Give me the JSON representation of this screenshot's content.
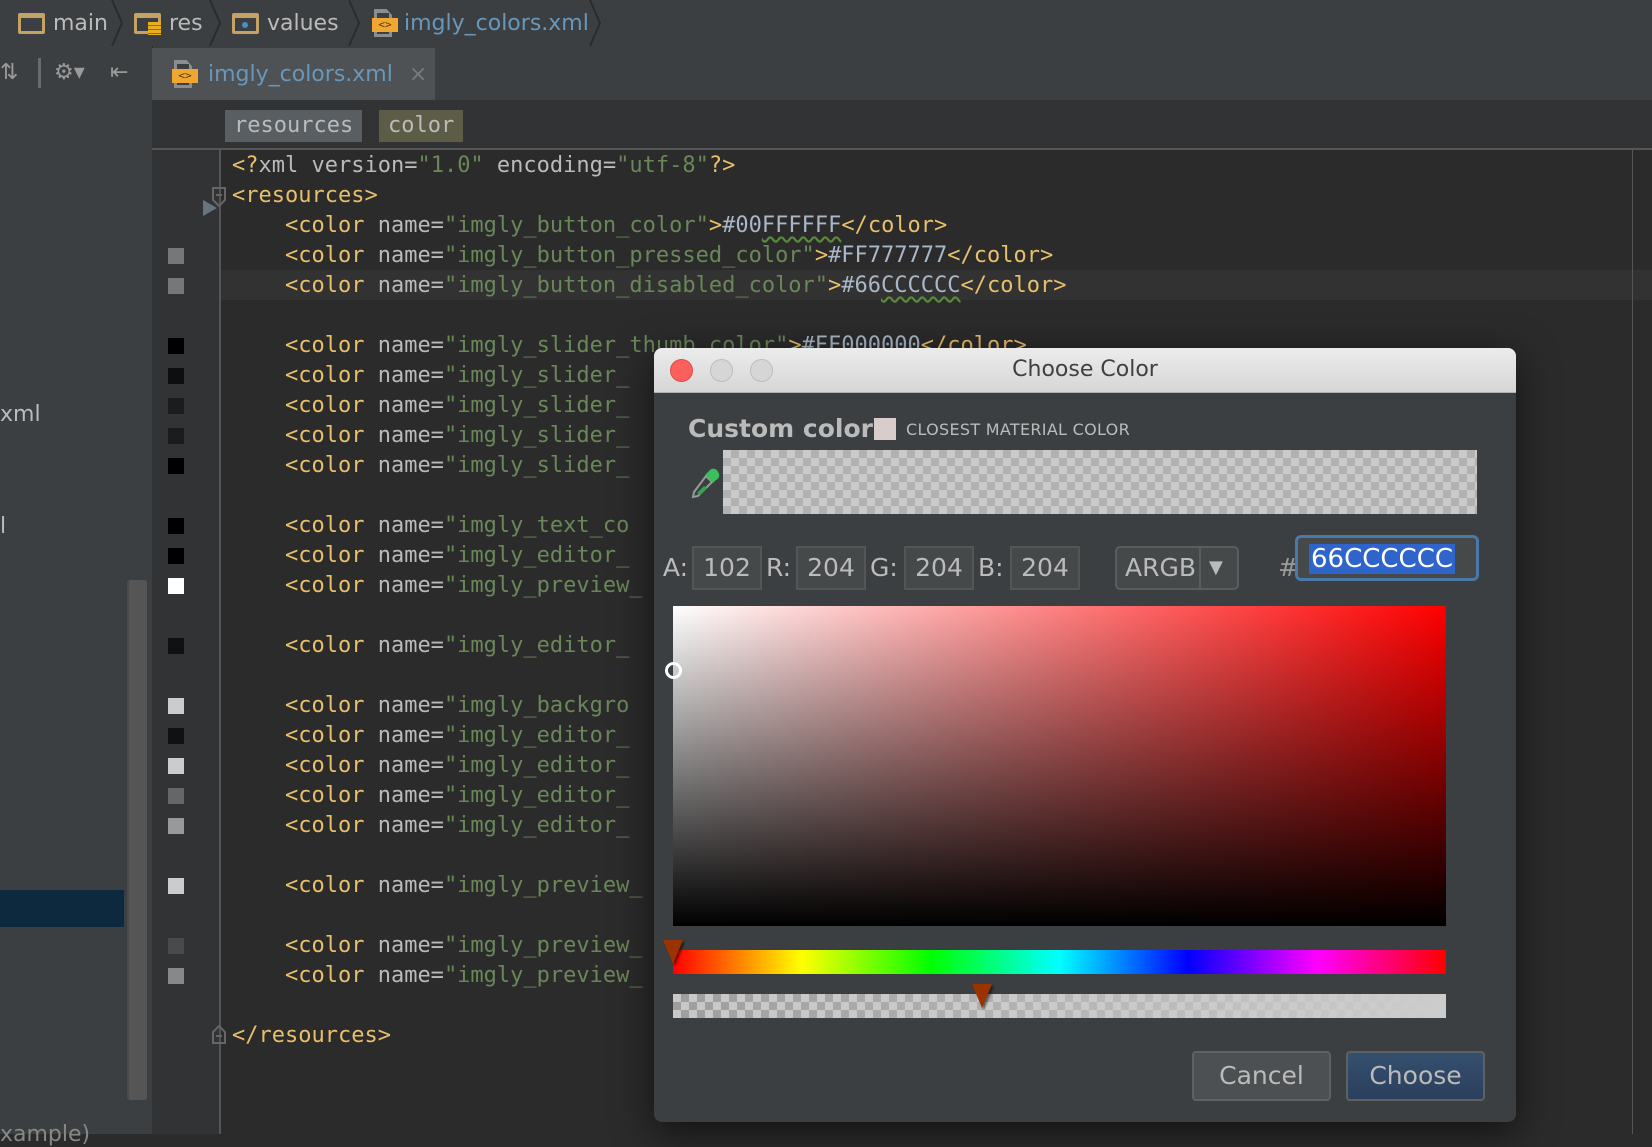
{
  "breadcrumb": {
    "items": [
      {
        "label": "main",
        "icon": "folder-icon"
      },
      {
        "label": "res",
        "icon": "resource-folder-icon"
      },
      {
        "label": "values",
        "icon": "values-folder-icon"
      },
      {
        "label": "imgly_colors.xml",
        "icon": "xml-file-icon"
      }
    ]
  },
  "toolbar": {
    "collapse_icon": "⇅",
    "gear_icon": "⚙▾",
    "hide_icon": "⇤"
  },
  "editor_tab": {
    "label": "imgly_colors.xml",
    "close": "×"
  },
  "left_panel": {
    "fragment_1": "xml",
    "fragment_2": "l",
    "fragment_3": "xample)"
  },
  "tag_path": [
    "resources",
    "color"
  ],
  "code": {
    "lines": [
      {
        "parts": [
          [
            "tag",
            "<?"
          ],
          [
            "attr",
            "xml version="
          ],
          [
            "str",
            "\"1.0\""
          ],
          [
            "attr",
            " encoding="
          ],
          [
            "str",
            "\"utf-8\""
          ],
          [
            "tag",
            "?>"
          ]
        ]
      },
      {
        "parts": [
          [
            "tag",
            "<resources>"
          ]
        ]
      },
      {
        "parts": [
          [
            "tag",
            "    <color "
          ],
          [
            "attr",
            "name="
          ],
          [
            "str",
            "\"imgly_button_color\""
          ],
          [
            "tag",
            ">"
          ],
          [
            "val",
            "#00"
          ],
          [
            "valsq",
            "FFFFFF"
          ],
          [
            "tag",
            "</color>"
          ]
        ]
      },
      {
        "parts": [
          [
            "tag",
            "    <color "
          ],
          [
            "attr",
            "name="
          ],
          [
            "str",
            "\"imgly_button_pressed_color\""
          ],
          [
            "tag",
            ">"
          ],
          [
            "val",
            "#FF777777"
          ],
          [
            "tag",
            "</color>"
          ]
        ],
        "swatch": "#777777"
      },
      {
        "parts": [
          [
            "tag",
            "    <color "
          ],
          [
            "attr",
            "name="
          ],
          [
            "str",
            "\"imgly_button_disabled_color\""
          ],
          [
            "tag",
            ">"
          ],
          [
            "val",
            "#66"
          ],
          [
            "valsq",
            "CCCCCC"
          ],
          [
            "tag",
            "</color>"
          ]
        ],
        "swatch": "#777777"
      },
      {
        "parts": []
      },
      {
        "parts": [
          [
            "tag",
            "    <color "
          ],
          [
            "attr",
            "name="
          ],
          [
            "str",
            "\"imgly_slider_thumb_color\""
          ],
          [
            "tag",
            ">"
          ],
          [
            "val",
            "#FF000000"
          ],
          [
            "tag",
            "</color>"
          ]
        ],
        "swatch": "#000000"
      },
      {
        "parts": [
          [
            "tag",
            "    <color "
          ],
          [
            "attr",
            "name="
          ],
          [
            "str",
            "\"imgly_slider_"
          ]
        ],
        "swatch": "#0e0e0e"
      },
      {
        "parts": [
          [
            "tag",
            "    <color "
          ],
          [
            "attr",
            "name="
          ],
          [
            "str",
            "\"imgly_slider_"
          ]
        ],
        "swatch": "#1c1c1c"
      },
      {
        "parts": [
          [
            "tag",
            "    <color "
          ],
          [
            "attr",
            "name="
          ],
          [
            "str",
            "\"imgly_slider_"
          ]
        ],
        "swatch": "#1c1c1c"
      },
      {
        "parts": [
          [
            "tag",
            "    <color "
          ],
          [
            "attr",
            "name="
          ],
          [
            "str",
            "\"imgly_slider_"
          ]
        ],
        "swatch": "#000000"
      },
      {
        "parts": []
      },
      {
        "parts": [
          [
            "tag",
            "    <color "
          ],
          [
            "attr",
            "name="
          ],
          [
            "str",
            "\"imgly_text_co"
          ]
        ],
        "swatch": "#000000"
      },
      {
        "parts": [
          [
            "tag",
            "    <color "
          ],
          [
            "attr",
            "name="
          ],
          [
            "str",
            "\"imgly_editor_"
          ]
        ],
        "swatch": "#000000"
      },
      {
        "parts": [
          [
            "tag",
            "    <color "
          ],
          [
            "attr",
            "name="
          ],
          [
            "str",
            "\"imgly_preview_"
          ]
        ],
        "swatch": "#ffffff"
      },
      {
        "parts": []
      },
      {
        "parts": [
          [
            "tag",
            "    <color "
          ],
          [
            "attr",
            "name="
          ],
          [
            "str",
            "\"imgly_editor_"
          ]
        ],
        "swatch": "#111111"
      },
      {
        "parts": []
      },
      {
        "parts": [
          [
            "tag",
            "    <color "
          ],
          [
            "attr",
            "name="
          ],
          [
            "str",
            "\"imgly_backgro"
          ]
        ],
        "swatch": "#cccccc"
      },
      {
        "parts": [
          [
            "tag",
            "    <color "
          ],
          [
            "attr",
            "name="
          ],
          [
            "str",
            "\"imgly_editor_"
          ]
        ],
        "swatch": "#111111"
      },
      {
        "parts": [
          [
            "tag",
            "    <color "
          ],
          [
            "attr",
            "name="
          ],
          [
            "str",
            "\"imgly_editor_"
          ]
        ],
        "swatch": "#cccccc"
      },
      {
        "parts": [
          [
            "tag",
            "    <color "
          ],
          [
            "attr",
            "name="
          ],
          [
            "str",
            "\"imgly_editor_"
          ]
        ],
        "swatch": "#666666"
      },
      {
        "parts": [
          [
            "tag",
            "    <color "
          ],
          [
            "attr",
            "name="
          ],
          [
            "str",
            "\"imgly_editor_"
          ]
        ],
        "swatch": "#999999"
      },
      {
        "parts": []
      },
      {
        "parts": [
          [
            "tag",
            "    <color "
          ],
          [
            "attr",
            "name="
          ],
          [
            "str",
            "\"imgly_preview_"
          ]
        ],
        "swatch": "#cccccc"
      },
      {
        "parts": []
      },
      {
        "parts": [
          [
            "tag",
            "    <color "
          ],
          [
            "attr",
            "name="
          ],
          [
            "str",
            "\"imgly_preview_"
          ]
        ],
        "swatch": "#4a4a4a"
      },
      {
        "parts": [
          [
            "tag",
            "    <color "
          ],
          [
            "attr",
            "name="
          ],
          [
            "str",
            "\"imgly_preview_"
          ]
        ],
        "swatch": "#888888"
      },
      {
        "parts": []
      },
      {
        "parts": [
          [
            "tag",
            "</resources>"
          ]
        ]
      }
    ]
  },
  "dialog": {
    "title": "Choose Color",
    "custom_color_label": "Custom color",
    "closest_material_label": "CLOSEST MATERIAL COLOR",
    "closest_material_color": "#d8cdca",
    "current_color": "#66CCCCCC",
    "fields": [
      {
        "label": "A:",
        "value": "102"
      },
      {
        "label": "R:",
        "value": "204"
      },
      {
        "label": "G:",
        "value": "204"
      },
      {
        "label": "B:",
        "value": "204"
      }
    ],
    "mode": {
      "selected": "ARGB",
      "arrow": "▼"
    },
    "hash_label": "#",
    "hex_value": "66CCCCCC",
    "hue_degrees": 0,
    "saturation": 0,
    "brightness": 0.8,
    "alpha_fraction": 0.4,
    "cancel_label": "Cancel",
    "choose_label": "Choose"
  }
}
